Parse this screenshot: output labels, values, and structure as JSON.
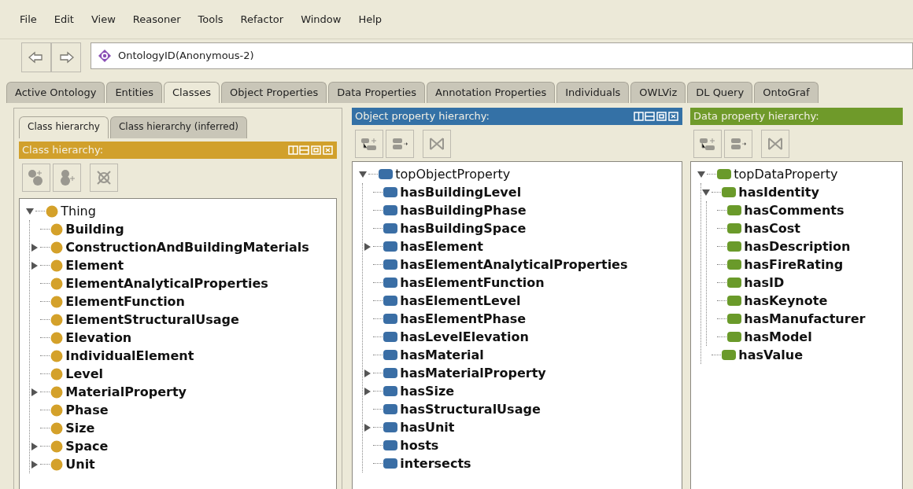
{
  "menu": [
    "File",
    "Edit",
    "View",
    "Reasoner",
    "Tools",
    "Refactor",
    "Window",
    "Help"
  ],
  "toolbar": {
    "ontology_id": "OntologyID(Anonymous-2)"
  },
  "tabs": [
    {
      "label": "Active Ontology",
      "selected": false
    },
    {
      "label": "Entities",
      "selected": false
    },
    {
      "label": "Classes",
      "selected": true
    },
    {
      "label": "Object Properties",
      "selected": false
    },
    {
      "label": "Data Properties",
      "selected": false
    },
    {
      "label": "Annotation Properties",
      "selected": false
    },
    {
      "label": "Individuals",
      "selected": false
    },
    {
      "label": "OWLViz",
      "selected": false
    },
    {
      "label": "DL Query",
      "selected": false
    },
    {
      "label": "OntoGraf",
      "selected": false
    }
  ],
  "panels": [
    {
      "kind": "class",
      "subtabs": [
        {
          "label": "Class hierarchy",
          "selected": true
        },
        {
          "label": "Class hierarchy (inferred)",
          "selected": false
        }
      ],
      "title": "Class hierarchy:",
      "color": "#d1a02c",
      "tree": [
        {
          "label": "Thing",
          "bold": false,
          "expanded": true,
          "children": [
            {
              "label": "Building",
              "bold": true
            },
            {
              "label": "ConstructionAndBuildingMaterials",
              "bold": true,
              "expanded": false
            },
            {
              "label": "Element",
              "bold": true,
              "expanded": false
            },
            {
              "label": "ElementAnalyticalProperties",
              "bold": true
            },
            {
              "label": "ElementFunction",
              "bold": true
            },
            {
              "label": "ElementStructuralUsage",
              "bold": true
            },
            {
              "label": "Elevation",
              "bold": true
            },
            {
              "label": "IndividualElement",
              "bold": true
            },
            {
              "label": "Level",
              "bold": true
            },
            {
              "label": "MaterialProperty",
              "bold": true,
              "expanded": false
            },
            {
              "label": "Phase",
              "bold": true
            },
            {
              "label": "Size",
              "bold": true
            },
            {
              "label": "Space",
              "bold": true,
              "expanded": false
            },
            {
              "label": "Unit",
              "bold": true,
              "expanded": false
            }
          ]
        }
      ]
    },
    {
      "kind": "object",
      "title": "Object property hierarchy:",
      "color": "#3471a6",
      "tree": [
        {
          "label": "topObjectProperty",
          "bold": false,
          "expanded": true,
          "children": [
            {
              "label": "hasBuildingLevel",
              "bold": true
            },
            {
              "label": "hasBuildingPhase",
              "bold": true
            },
            {
              "label": "hasBuildingSpace",
              "bold": true
            },
            {
              "label": "hasElement",
              "bold": true,
              "expanded": false
            },
            {
              "label": "hasElementAnalyticalProperties",
              "bold": true
            },
            {
              "label": "hasElementFunction",
              "bold": true
            },
            {
              "label": "hasElementLevel",
              "bold": true
            },
            {
              "label": "hasElementPhase",
              "bold": true
            },
            {
              "label": "hasLevelElevation",
              "bold": true
            },
            {
              "label": "hasMaterial",
              "bold": true
            },
            {
              "label": "hasMaterialProperty",
              "bold": true,
              "expanded": false
            },
            {
              "label": "hasSize",
              "bold": true,
              "expanded": false
            },
            {
              "label": "hasStructuralUsage",
              "bold": true
            },
            {
              "label": "hasUnit",
              "bold": true,
              "expanded": false
            },
            {
              "label": "hosts",
              "bold": true
            },
            {
              "label": "intersects",
              "bold": true
            }
          ]
        }
      ]
    },
    {
      "kind": "data",
      "title": "Data property hierarchy:",
      "color": "#6f9a2a",
      "tree": [
        {
          "label": "topDataProperty",
          "bold": false,
          "expanded": true,
          "children": [
            {
              "label": "hasIdentity",
              "bold": true,
              "expanded": true,
              "children": [
                {
                  "label": "hasComments",
                  "bold": true
                },
                {
                  "label": "hasCost",
                  "bold": true
                },
                {
                  "label": "hasDescription",
                  "bold": true
                },
                {
                  "label": "hasFireRating",
                  "bold": true
                },
                {
                  "label": "hasID",
                  "bold": true
                },
                {
                  "label": "hasKeynote",
                  "bold": true
                },
                {
                  "label": "hasManufacturer",
                  "bold": true
                },
                {
                  "label": "hasModel",
                  "bold": true
                }
              ]
            },
            {
              "label": "hasValue",
              "bold": true
            }
          ]
        }
      ]
    }
  ]
}
